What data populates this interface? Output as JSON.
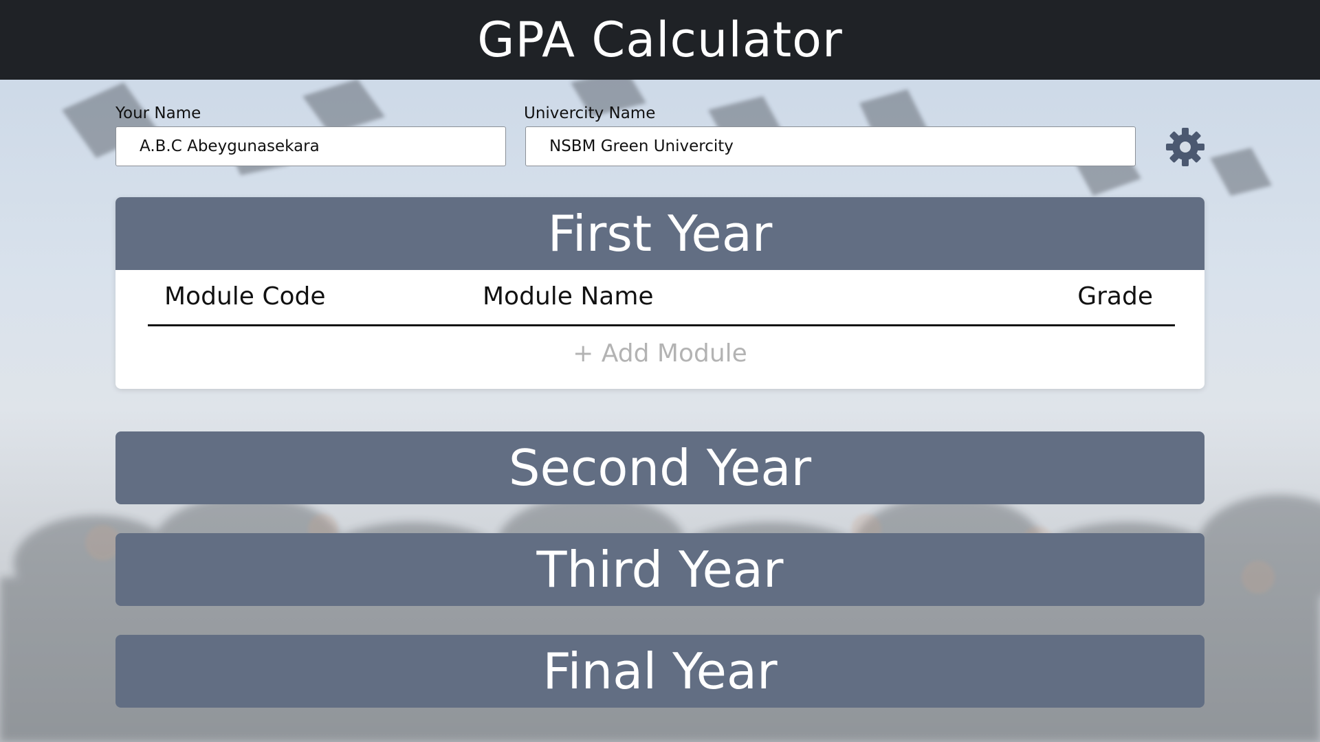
{
  "app": {
    "title": "GPA Calculator"
  },
  "form": {
    "name_label": "Your Name",
    "name_value": "A.B.C Abeygunasekara",
    "university_label": "Univercity Name",
    "university_value": "NSBM Green Univercity"
  },
  "settings": {
    "icon": "gear-icon"
  },
  "years": {
    "first": {
      "title": "First Year",
      "columns": {
        "code": "Module Code",
        "name": "Module Name",
        "grade": "Grade"
      },
      "add_label": "+ Add Module"
    },
    "second": {
      "title": "Second Year"
    },
    "third": {
      "title": "Third Year"
    },
    "final": {
      "title": "Final Year"
    }
  },
  "colors": {
    "topbar": "#1f2226",
    "year_header": "#626e83",
    "gear": "#4b5870",
    "add_module_text": "#b3b3b3"
  }
}
